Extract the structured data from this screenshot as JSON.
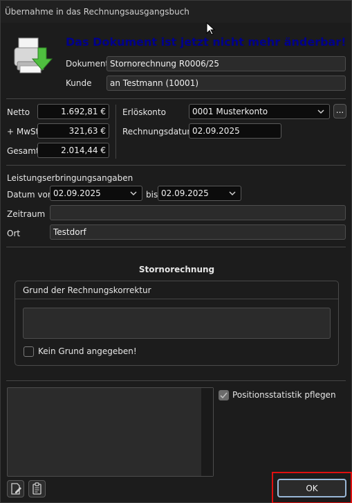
{
  "window": {
    "title": "Übernahme in das Rechnungsausgangsbuch"
  },
  "header": {
    "headline": "Das Dokument ist jetzt nicht mehr änderbar!"
  },
  "document": {
    "dokument_label": "Dokument",
    "dokument_value": "Stornorechnung R0006/25",
    "kunde_label": "Kunde",
    "kunde_value": "an  Testmann (10001)"
  },
  "amounts": {
    "netto_label": "Netto",
    "netto_value": "1.692,81 €",
    "mwst_label": "+ MwSt",
    "mwst_value": "321,63 €",
    "gesamt_label": "Gesamt",
    "gesamt_value": "2.014,44 €"
  },
  "account": {
    "erloeskonto_label": "Erlöskonto",
    "erloeskonto_value": "0001 Musterkonto",
    "more_button": "...",
    "rechnungsdatum_label": "Rechnungsdatum",
    "rechnungsdatum_value": "02.09.2025"
  },
  "leistung": {
    "section_label": "Leistungserbringungsangaben",
    "datum_von_label": "Datum von",
    "datum_von_value": "02.09.2025",
    "bis_label": "bis",
    "bis_value": "02.09.2025",
    "zeitraum_label": "Zeitraum",
    "zeitraum_value": "",
    "ort_label": "Ort",
    "ort_value": "Testdorf"
  },
  "korrektur": {
    "section_title": "Stornorechnung",
    "group_title": "Grund der Rechnungskorrektur",
    "grund_value": "",
    "kein_grund_label": "Kein Grund angegeben!",
    "kein_grund_checked": false
  },
  "options": {
    "positionsstatistik_label": "Positionsstatistik pflegen",
    "positionsstatistik_checked": true
  },
  "footer": {
    "ok_label": "OK"
  },
  "icons": [
    "printer-download-icon",
    "chevron-down-icon",
    "edit-document-icon",
    "clipboard-icon"
  ],
  "colors": {
    "headline": "#00008b",
    "ok_highlight": "#e01010",
    "background": "#1c1c1c"
  }
}
